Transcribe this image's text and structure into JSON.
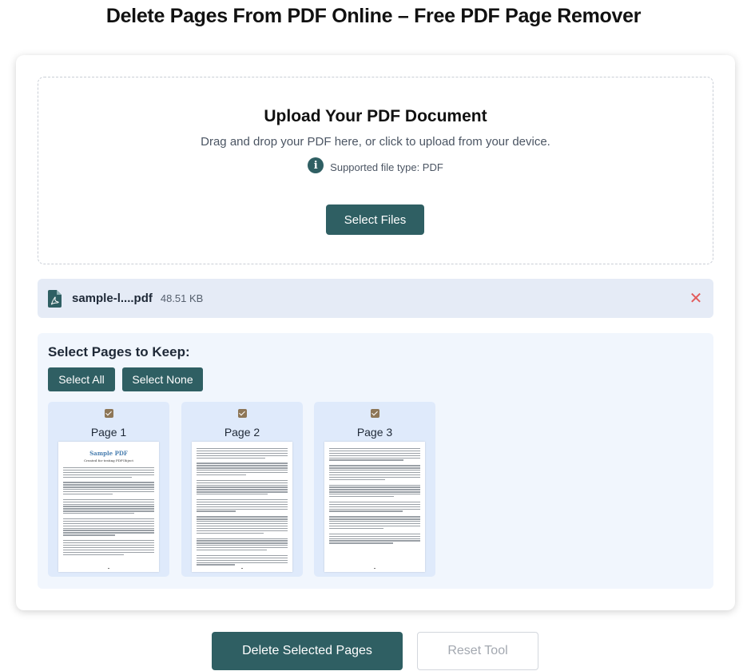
{
  "header": {
    "title": "Delete Pages From PDF Online – Free PDF Page Remover"
  },
  "upload": {
    "title": "Upload Your PDF Document",
    "subtitle": "Drag and drop your PDF here, or click to upload from your device.",
    "info_icon": "info-icon",
    "supported_text": "Supported file type: PDF",
    "select_button": "Select Files"
  },
  "file": {
    "icon": "pdf-file-icon",
    "name": "sample-l....pdf",
    "size": "48.51 KB",
    "remove_icon": "close-icon",
    "remove_symbol": "✕"
  },
  "pages": {
    "heading": "Select Pages to Keep:",
    "select_all": "Select All",
    "select_none": "Select None",
    "items": [
      {
        "label": "Page 1",
        "checked": true,
        "thumb_title": "Sample PDF",
        "thumb_subtitle": "Created for testing PDFObject"
      },
      {
        "label": "Page 2",
        "checked": true
      },
      {
        "label": "Page 3",
        "checked": true
      }
    ]
  },
  "actions": {
    "delete_button": "Delete Selected Pages",
    "reset_button": "Reset Tool"
  },
  "colors": {
    "primary": "#2f5f63",
    "checkbox": "#8d7657",
    "remove": "#e25b5b",
    "file_row_bg": "#e5ebf6",
    "pages_panel_bg": "#f1f6fd",
    "page_card_bg": "#dfeafb"
  }
}
